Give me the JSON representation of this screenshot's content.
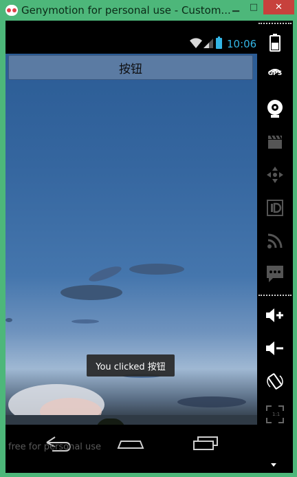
{
  "window": {
    "title": "Genymotion for personal use - Custom...",
    "controls": {
      "minimize": "▁",
      "maximize": "□",
      "close": "✕"
    }
  },
  "status_bar": {
    "time": "10:06",
    "icons": [
      "wifi-icon",
      "signal-icon",
      "battery-icon"
    ]
  },
  "app": {
    "button_label": "按钮",
    "toast_text": "You clicked 按钮",
    "watermark": "free for personal use"
  },
  "nav_bar": {
    "buttons": [
      "back-icon",
      "home-icon",
      "recents-icon"
    ]
  },
  "sidebar": {
    "tools": [
      "battery-icon",
      "gps-icon",
      "camera-icon",
      "video-icon",
      "dpad-icon",
      "id-icon",
      "cast-icon",
      "sms-icon",
      "volume-up-icon",
      "volume-down-icon",
      "rotate-icon",
      "pixel-perfect-icon"
    ],
    "gps_label": "GPS",
    "pixel_label": "1:1"
  },
  "colors": {
    "accent": "#33b5e5",
    "window_frame": "#4db77a",
    "close_button": "#c7413c"
  }
}
